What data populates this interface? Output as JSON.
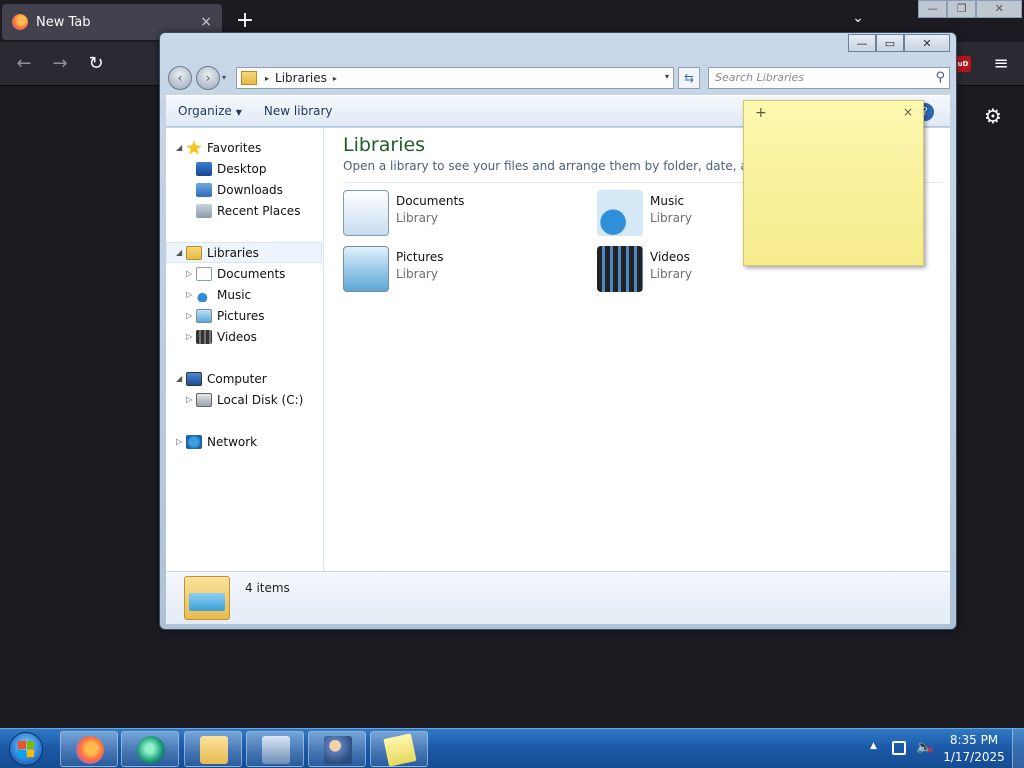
{
  "firefox": {
    "tab_title": "New Tab",
    "tab_close": "×",
    "new_tab": "+",
    "tab_list": "⌄",
    "back": "←",
    "forward": "→",
    "reload": "↻",
    "ublock": "uD",
    "menu": "≡",
    "settings": "⚙"
  },
  "outer_window": {
    "minimize": "—",
    "maximize": "❐",
    "close": "✕"
  },
  "explorer": {
    "controls": {
      "minimize": "—",
      "maximize": "▭",
      "close": "✕"
    },
    "nav": {
      "back": "‹",
      "forward": "›",
      "history": "▾"
    },
    "address": {
      "crumb": "Libraries",
      "arrow_before": "▸",
      "arrow_after": "▸",
      "dropdown": "▾"
    },
    "refresh": "⇆",
    "search": {
      "placeholder": "Search Libraries",
      "icon": "⚲"
    },
    "toolbar": {
      "organize": "Organize",
      "organize_caret": "▼",
      "new_library": "New library",
      "help": "?"
    },
    "navpane": [
      {
        "label": "Favorites",
        "icon": "star-icon",
        "expanded": true,
        "level": 0
      },
      {
        "label": "Desktop",
        "icon": "desktop-icon",
        "level": 1
      },
      {
        "label": "Downloads",
        "icon": "downloads-icon",
        "level": 1
      },
      {
        "label": "Recent Places",
        "icon": "recent-places-icon",
        "level": 1
      },
      {
        "label": "Libraries",
        "icon": "libraries-icon",
        "expanded": true,
        "level": 0,
        "selected": true
      },
      {
        "label": "Documents",
        "icon": "documents-icon",
        "level": 1
      },
      {
        "label": "Music",
        "icon": "music-icon",
        "level": 1
      },
      {
        "label": "Pictures",
        "icon": "pictures-icon",
        "level": 1
      },
      {
        "label": "Videos",
        "icon": "videos-icon",
        "level": 1
      },
      {
        "label": "Computer",
        "icon": "computer-icon",
        "expanded": true,
        "level": 0
      },
      {
        "label": "Local Disk (C:)",
        "icon": "disk-icon",
        "level": 1
      },
      {
        "label": "Network",
        "icon": "network-icon",
        "expanded": false,
        "level": 0
      }
    ],
    "content": {
      "title": "Libraries",
      "subtitle": "Open a library to see your files and arrange them by folder, date, and other p",
      "libraries": [
        {
          "name": "Documents",
          "kind": "Library",
          "icon": "documents-library-icon"
        },
        {
          "name": "Music",
          "kind": "Library",
          "icon": "music-library-icon"
        },
        {
          "name": "Pictures",
          "kind": "Library",
          "icon": "pictures-library-icon"
        },
        {
          "name": "Videos",
          "kind": "Library",
          "icon": "videos-library-icon"
        }
      ]
    },
    "details": {
      "count": "4 items"
    }
  },
  "sticky_note": {
    "add": "+",
    "close": "×"
  },
  "taskbar": {
    "tasks": [
      "firefox-icon",
      "media-player-icon",
      "explorer-icon",
      "remote-desktop-icon",
      "users-icon",
      "sticky-notes-icon"
    ],
    "clock": {
      "time": "8:35 PM",
      "date": "1/17/2025"
    },
    "tray_up": "▲"
  },
  "colors": {
    "taskbar": "#1b58a5",
    "title_green": "#1e5d26",
    "sticky": "#fdf8b0"
  }
}
